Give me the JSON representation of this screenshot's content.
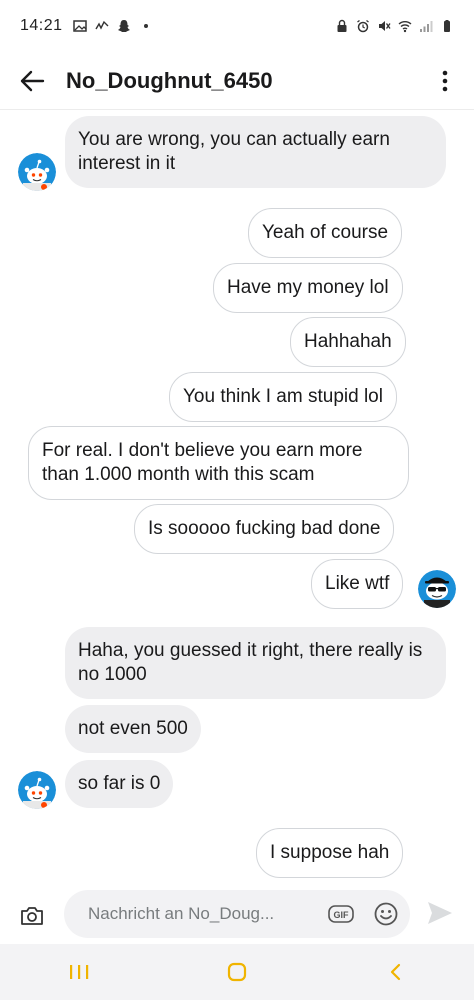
{
  "status_bar": {
    "time": "14:21"
  },
  "header": {
    "title": "No_Doughnut_6450"
  },
  "messages": [
    {
      "id": "m1",
      "side": "in",
      "text": "You are wrong, you can actually earn interest in it"
    },
    {
      "id": "m2",
      "side": "out",
      "text": "Yeah of course"
    },
    {
      "id": "m3",
      "side": "out",
      "text": "Have my money lol"
    },
    {
      "id": "m4",
      "side": "out",
      "text": "Hahhahah"
    },
    {
      "id": "m5",
      "side": "out",
      "text": "You think I am stupid lol"
    },
    {
      "id": "m6",
      "side": "out",
      "text": "For real. I don't believe you earn more than 1.000 month with this scam"
    },
    {
      "id": "m7",
      "side": "out",
      "text": "Is sooooo fucking bad done"
    },
    {
      "id": "m8",
      "side": "out",
      "text": "Like wtf"
    },
    {
      "id": "m9",
      "side": "in",
      "text": "Haha, you guessed it right, there really is no 1000"
    },
    {
      "id": "m10",
      "side": "in",
      "text": "not even 500"
    },
    {
      "id": "m11",
      "side": "in",
      "text": "so far is 0"
    },
    {
      "id": "m12",
      "side": "out",
      "text": "I suppose hah"
    }
  ],
  "composer": {
    "placeholder": "Nachricht an No_Doug...",
    "gif_label": "GIF"
  },
  "colors": {
    "incoming_bubble": "#eeeef0",
    "outgoing_border": "#d3d6da",
    "avatar_blue": "#1a8fd8",
    "reddit_orange": "#ff4500"
  },
  "icons": {
    "back": "arrow-left-icon",
    "more": "vertical-dots-icon",
    "camera": "camera-icon",
    "emoji": "smiley-icon",
    "send": "send-arrow-icon"
  }
}
